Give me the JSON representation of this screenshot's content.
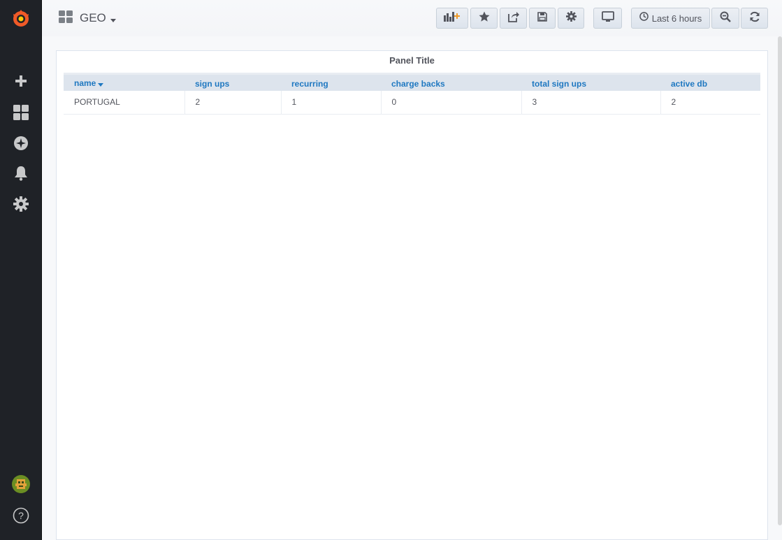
{
  "dashboard": {
    "title": "GEO"
  },
  "navbar": {
    "time_range_label": "Last 6 hours"
  },
  "panel": {
    "title": "Panel Title",
    "columns": [
      "name",
      "sign ups",
      "recurring",
      "charge backs",
      "total sign ups",
      "active db"
    ],
    "rows": [
      [
        "PORTUGAL",
        "2",
        "1",
        "0",
        "3",
        "2"
      ]
    ]
  },
  "sidebar": {
    "help_label": "?"
  },
  "colors": {
    "sidebar_bg": "#1f2227",
    "header_link": "#1f78c1",
    "logo_orange": "#f05a28"
  },
  "icons": {
    "sidebar": [
      "grafana-logo-icon",
      "plus-icon",
      "dashboards-icon",
      "explore-compass-icon",
      "bell-icon",
      "gear-icon",
      "user-avatar-icon",
      "help-icon"
    ],
    "navbar": [
      "add-panel-icon",
      "star-icon",
      "share-icon",
      "save-icon",
      "settings-gear-icon",
      "tv-monitor-icon",
      "clock-icon",
      "zoom-out-icon",
      "refresh-icon"
    ]
  }
}
